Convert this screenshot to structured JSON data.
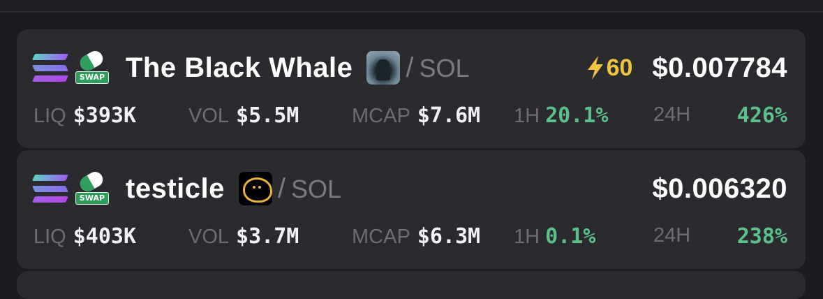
{
  "pairs": [
    {
      "name": "The Black Whale",
      "quote": "SOL",
      "separator": "/",
      "boost": "60",
      "price": "$0.007784",
      "liq_label": "LIQ",
      "liq": "$393K",
      "vol_label": "VOL",
      "vol": "$5.5M",
      "mcap_label": "MCAP",
      "mcap": "$7.6M",
      "h1_label": "1H",
      "h1": "20.1%",
      "h24_label": "24H",
      "h24": "426%",
      "icon": "whale-token-image"
    },
    {
      "name": "testicle",
      "quote": "SOL",
      "separator": "/",
      "price": "$0.006320",
      "liq_label": "LIQ",
      "liq": "$403K",
      "vol_label": "VOL",
      "vol": "$3.7M",
      "mcap_label": "MCAP",
      "mcap": "$6.3M",
      "h1_label": "1H",
      "h1": "0.1%",
      "h24_label": "24H",
      "h24": "238%",
      "icon": "blob-token-image"
    }
  ],
  "badges": {
    "swap": "SWAP"
  },
  "colors": {
    "background": "#1b1b1f",
    "card": "#2a2a2f",
    "positive": "#5cc08a",
    "boost": "#f0c343",
    "muted": "#6d6d76"
  }
}
